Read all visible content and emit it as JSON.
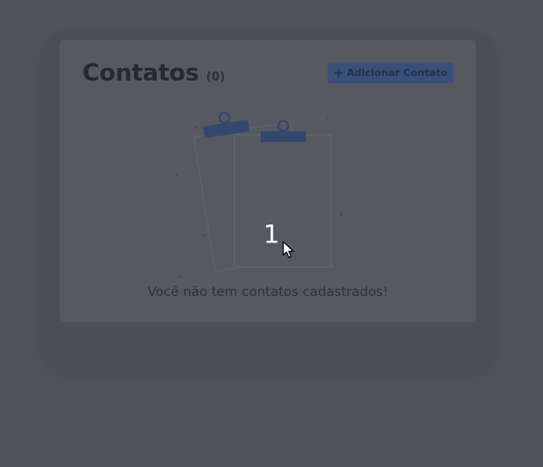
{
  "page": {
    "title": "Contatos",
    "count": "(0)",
    "add_button_label": "Adicionar Contato",
    "add_button_icon": "plus-icon",
    "empty_message": "Você não tem contatos cadastrados!",
    "empty_illustration": "clipboard-icon",
    "overlay_countdown": "1"
  },
  "colors": {
    "overlay_background": "#51545d",
    "card_background": "#565960",
    "accent": "#3a4f7a",
    "title_text": "#26292e"
  }
}
